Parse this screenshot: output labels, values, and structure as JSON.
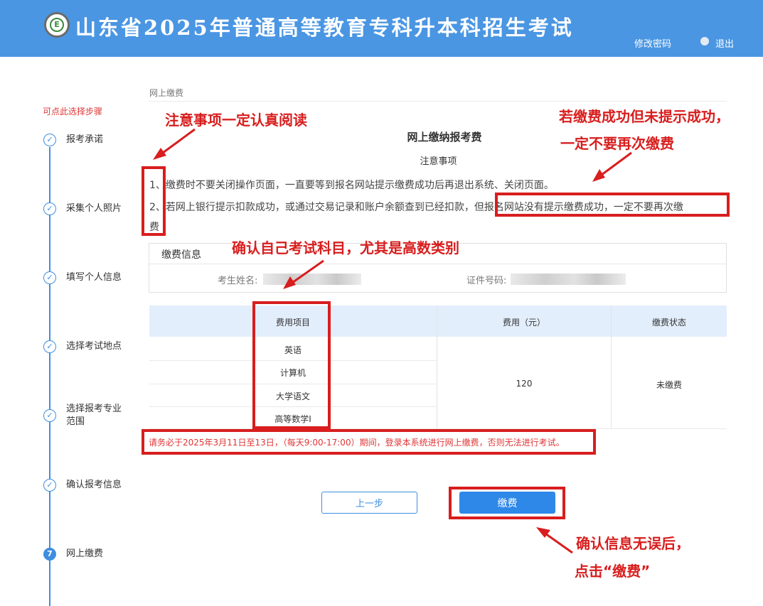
{
  "header": {
    "logo_letter": "E",
    "title": "山东省2025年普通高等教育专科升本科招生考试",
    "change_password": "修改密码",
    "logout": "退出",
    "bg_color": "#4a96e3"
  },
  "sidebar": {
    "hint": "可点此选择步骤",
    "steps": [
      {
        "label": "报考承诺",
        "state": "done"
      },
      {
        "label": "采集个人照片",
        "state": "done"
      },
      {
        "label": "填写个人信息",
        "state": "done"
      },
      {
        "label": "选择考试地点",
        "state": "done"
      },
      {
        "label": "选择报考专业范围",
        "state": "done"
      },
      {
        "label": "确认报考信息",
        "state": "done"
      },
      {
        "label": "网上缴费",
        "state": "current",
        "number": "7"
      }
    ],
    "check_glyph": "✓"
  },
  "main": {
    "breadcrumb": "网上缴费",
    "title": "网上缴纳报考费",
    "notice_title": "注意事项",
    "notice_1": "1、缴费时不要关闭操作页面，一直要等到报名网站提示缴费成功后再退出系统、关闭页面。",
    "notice_2": "2、若网上银行提示扣款成功，或通过交易记录和账户余额查到已经扣款，但报名网站没有提示缴费成功，一定不要再次缴",
    "notice_2_cont": "费",
    "info": {
      "title": "缴费信息",
      "name_label": "考生姓名:",
      "id_label": "证件号码:"
    },
    "table": {
      "headers": [
        "费用项目",
        "费用（元）",
        "缴费状态"
      ],
      "items": [
        "英语",
        "计算机",
        "大学语文",
        "高等数学I"
      ],
      "fee": "120",
      "status": "未缴费"
    },
    "warning": "请务必于2025年3月11日至13日，（每天9:00-17:00）期间，登录本系统进行网上缴费，否则无法进行考试。",
    "prev_button": "上一步",
    "pay_button": "缴费"
  },
  "annotations": {
    "read_carefully": "注意事项一定认真阅读",
    "no_repeat_line1": "若缴费成功但未提示成功，",
    "no_repeat_line2": "一定不要再次缴费",
    "confirm_subjects": "确认自己考试科目，尤其是高数类别",
    "confirm_info_line1": "确认信息无误后，",
    "confirm_info_line2": "点击“缴费”",
    "color": "#d81e1e"
  }
}
